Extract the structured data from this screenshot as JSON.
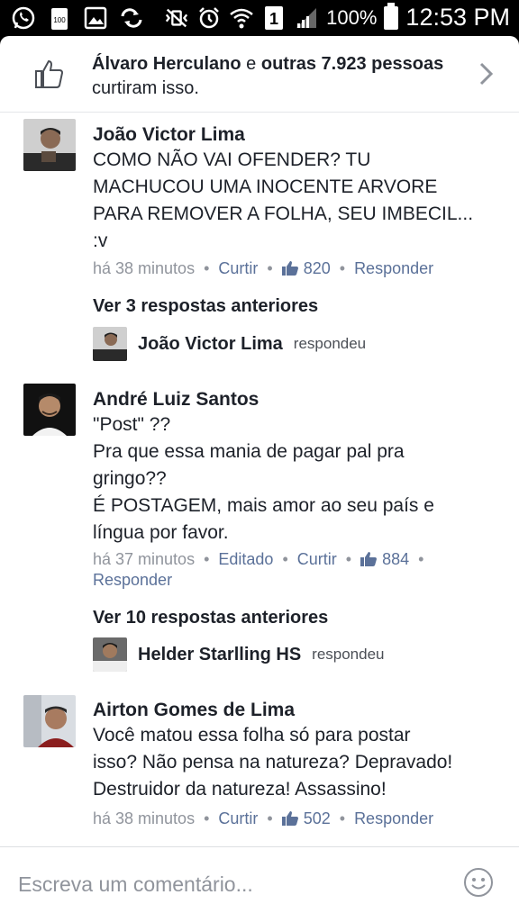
{
  "status_bar": {
    "battery_percent": "100%",
    "time": "12:53 PM",
    "sim_badge": "1",
    "battery_small": "100",
    "icons": [
      "whatsapp-icon",
      "battery-saver-icon",
      "gallery-icon",
      "sync-icon",
      "mute-vibrate-icon",
      "alarm-icon",
      "wifi-icon",
      "sim-icon",
      "signal-icon",
      "battery-icon"
    ]
  },
  "likes": {
    "name": "Álvaro Herculano",
    "connector": " e ",
    "others": "outras 7.923 pessoas",
    "suffix": "curtiram isso."
  },
  "comments": [
    {
      "author": "João Victor Lima",
      "text": "COMO NÃO VAI OFENDER? TU\nMACHUCOU UMA INOCENTE ARVORE\nPARA REMOVER A FOLHA, SEU IMBECIL...\n:v",
      "time": "há 38 minutos",
      "like_label": "Curtir",
      "like_count": "820",
      "reply_label": "Responder",
      "previous_replies": "Ver 3 respostas anteriores",
      "last_replier": "João Victor Lima",
      "replied_verb": "respondeu"
    },
    {
      "author": "André Luiz Santos",
      "text": "\"Post\" ??\nPra que essa mania de pagar pal pra\ngringo??\nÉ POSTAGEM, mais amor ao seu país e\nlíngua por favor.",
      "time": "há 37 minutos",
      "edited_label": "Editado",
      "like_label": "Curtir",
      "like_count": "884",
      "reply_label": "Responder",
      "previous_replies": "Ver 10 respostas anteriores",
      "last_replier": "Helder Starlling HS",
      "replied_verb": "respondeu"
    },
    {
      "author": "Airton Gomes de Lima",
      "text": "Você matou essa folha só para postar\nisso? Não pensa na natureza? Depravado!\nDestruidor da natureza! Assassino!",
      "time": "há 38 minutos",
      "like_label": "Curtir",
      "like_count": "502",
      "reply_label": "Responder"
    }
  ],
  "composer": {
    "placeholder": "Escreva um comentário..."
  },
  "colors": {
    "link": "#5b7199",
    "meta": "#90949c",
    "text": "#1d2129"
  }
}
